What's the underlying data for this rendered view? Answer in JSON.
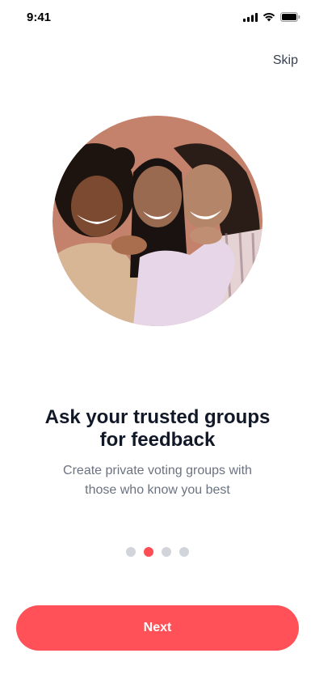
{
  "status_bar": {
    "time": "9:41"
  },
  "header": {
    "skip_label": "Skip"
  },
  "hero": {
    "alt": "Three smiling women embracing"
  },
  "content": {
    "title_line1": "Ask your trusted groups",
    "title_line2": "for feedback",
    "subtitle_line1": "Create private voting groups with",
    "subtitle_line2": "those who know you best"
  },
  "pagination": {
    "total": 4,
    "active_index": 1,
    "active_color": "#ff4d55",
    "inactive_color": "#d1d5db"
  },
  "footer": {
    "next_label": "Next",
    "button_color": "#ff5157"
  }
}
